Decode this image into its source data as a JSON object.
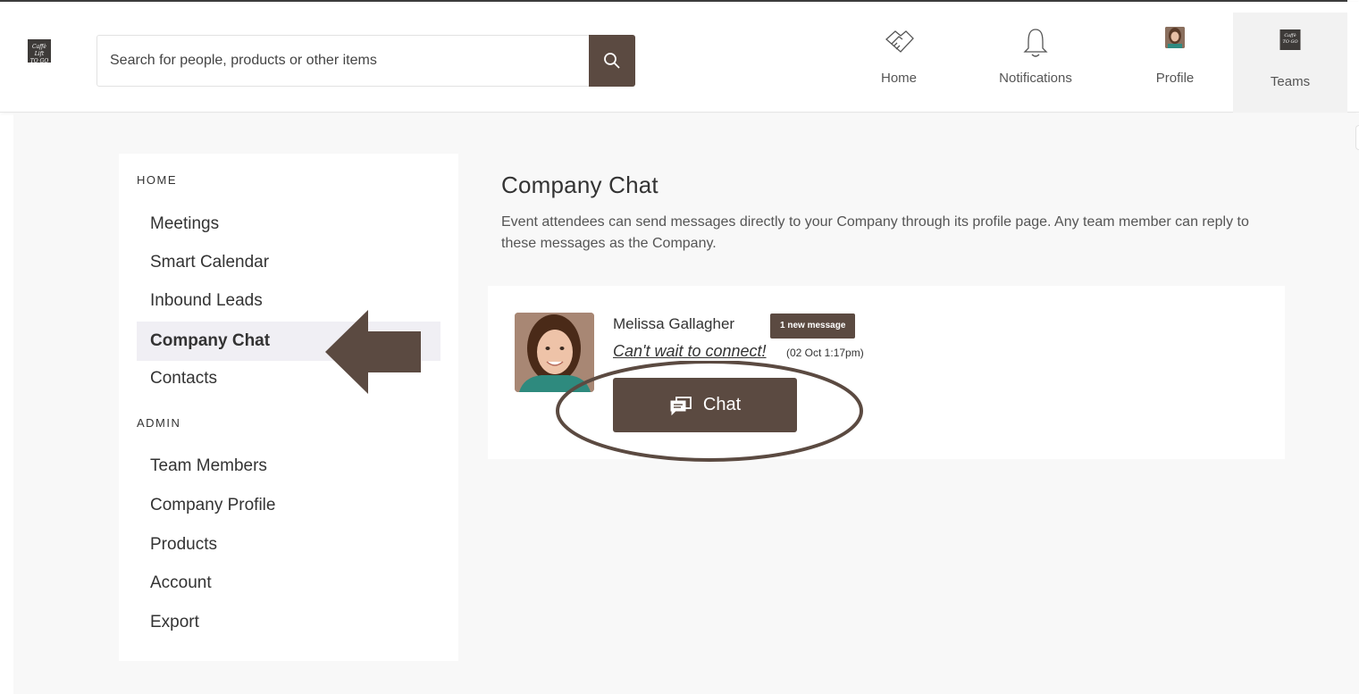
{
  "header": {
    "logo_text": "Caffè Lift TO GO",
    "search": {
      "placeholder": "Search for people, products or other items",
      "value": ""
    },
    "nav": [
      {
        "label": "Home",
        "icon": "handshake-icon"
      },
      {
        "label": "Notifications",
        "icon": "bell-icon"
      },
      {
        "label": "Profile",
        "icon": "avatar"
      },
      {
        "label": "Teams",
        "icon": "team-logo"
      }
    ]
  },
  "sidebar": {
    "sections": [
      {
        "heading": "HOME",
        "items": [
          "Meetings",
          "Smart Calendar",
          "Inbound Leads",
          "Company Chat",
          "Contacts"
        ]
      },
      {
        "heading": "ADMIN",
        "items": [
          "Team Members",
          "Company Profile",
          "Products",
          "Account",
          "Export"
        ]
      }
    ],
    "active_item": "Company Chat"
  },
  "main": {
    "title": "Company Chat",
    "description": "Event attendees can send messages directly to your Company through its profile page. Any team member can reply to these messages as the Company.",
    "chats": [
      {
        "name": "Melissa Gallagher",
        "badge": "1 new message",
        "message": "Can't wait to connect!",
        "time": "(02 Oct 1:17pm)",
        "button_label": "Chat"
      }
    ]
  },
  "colors": {
    "brand": "#5b4a41",
    "active_bg": "#f0eff4",
    "page_bg": "#f8f8f8"
  }
}
